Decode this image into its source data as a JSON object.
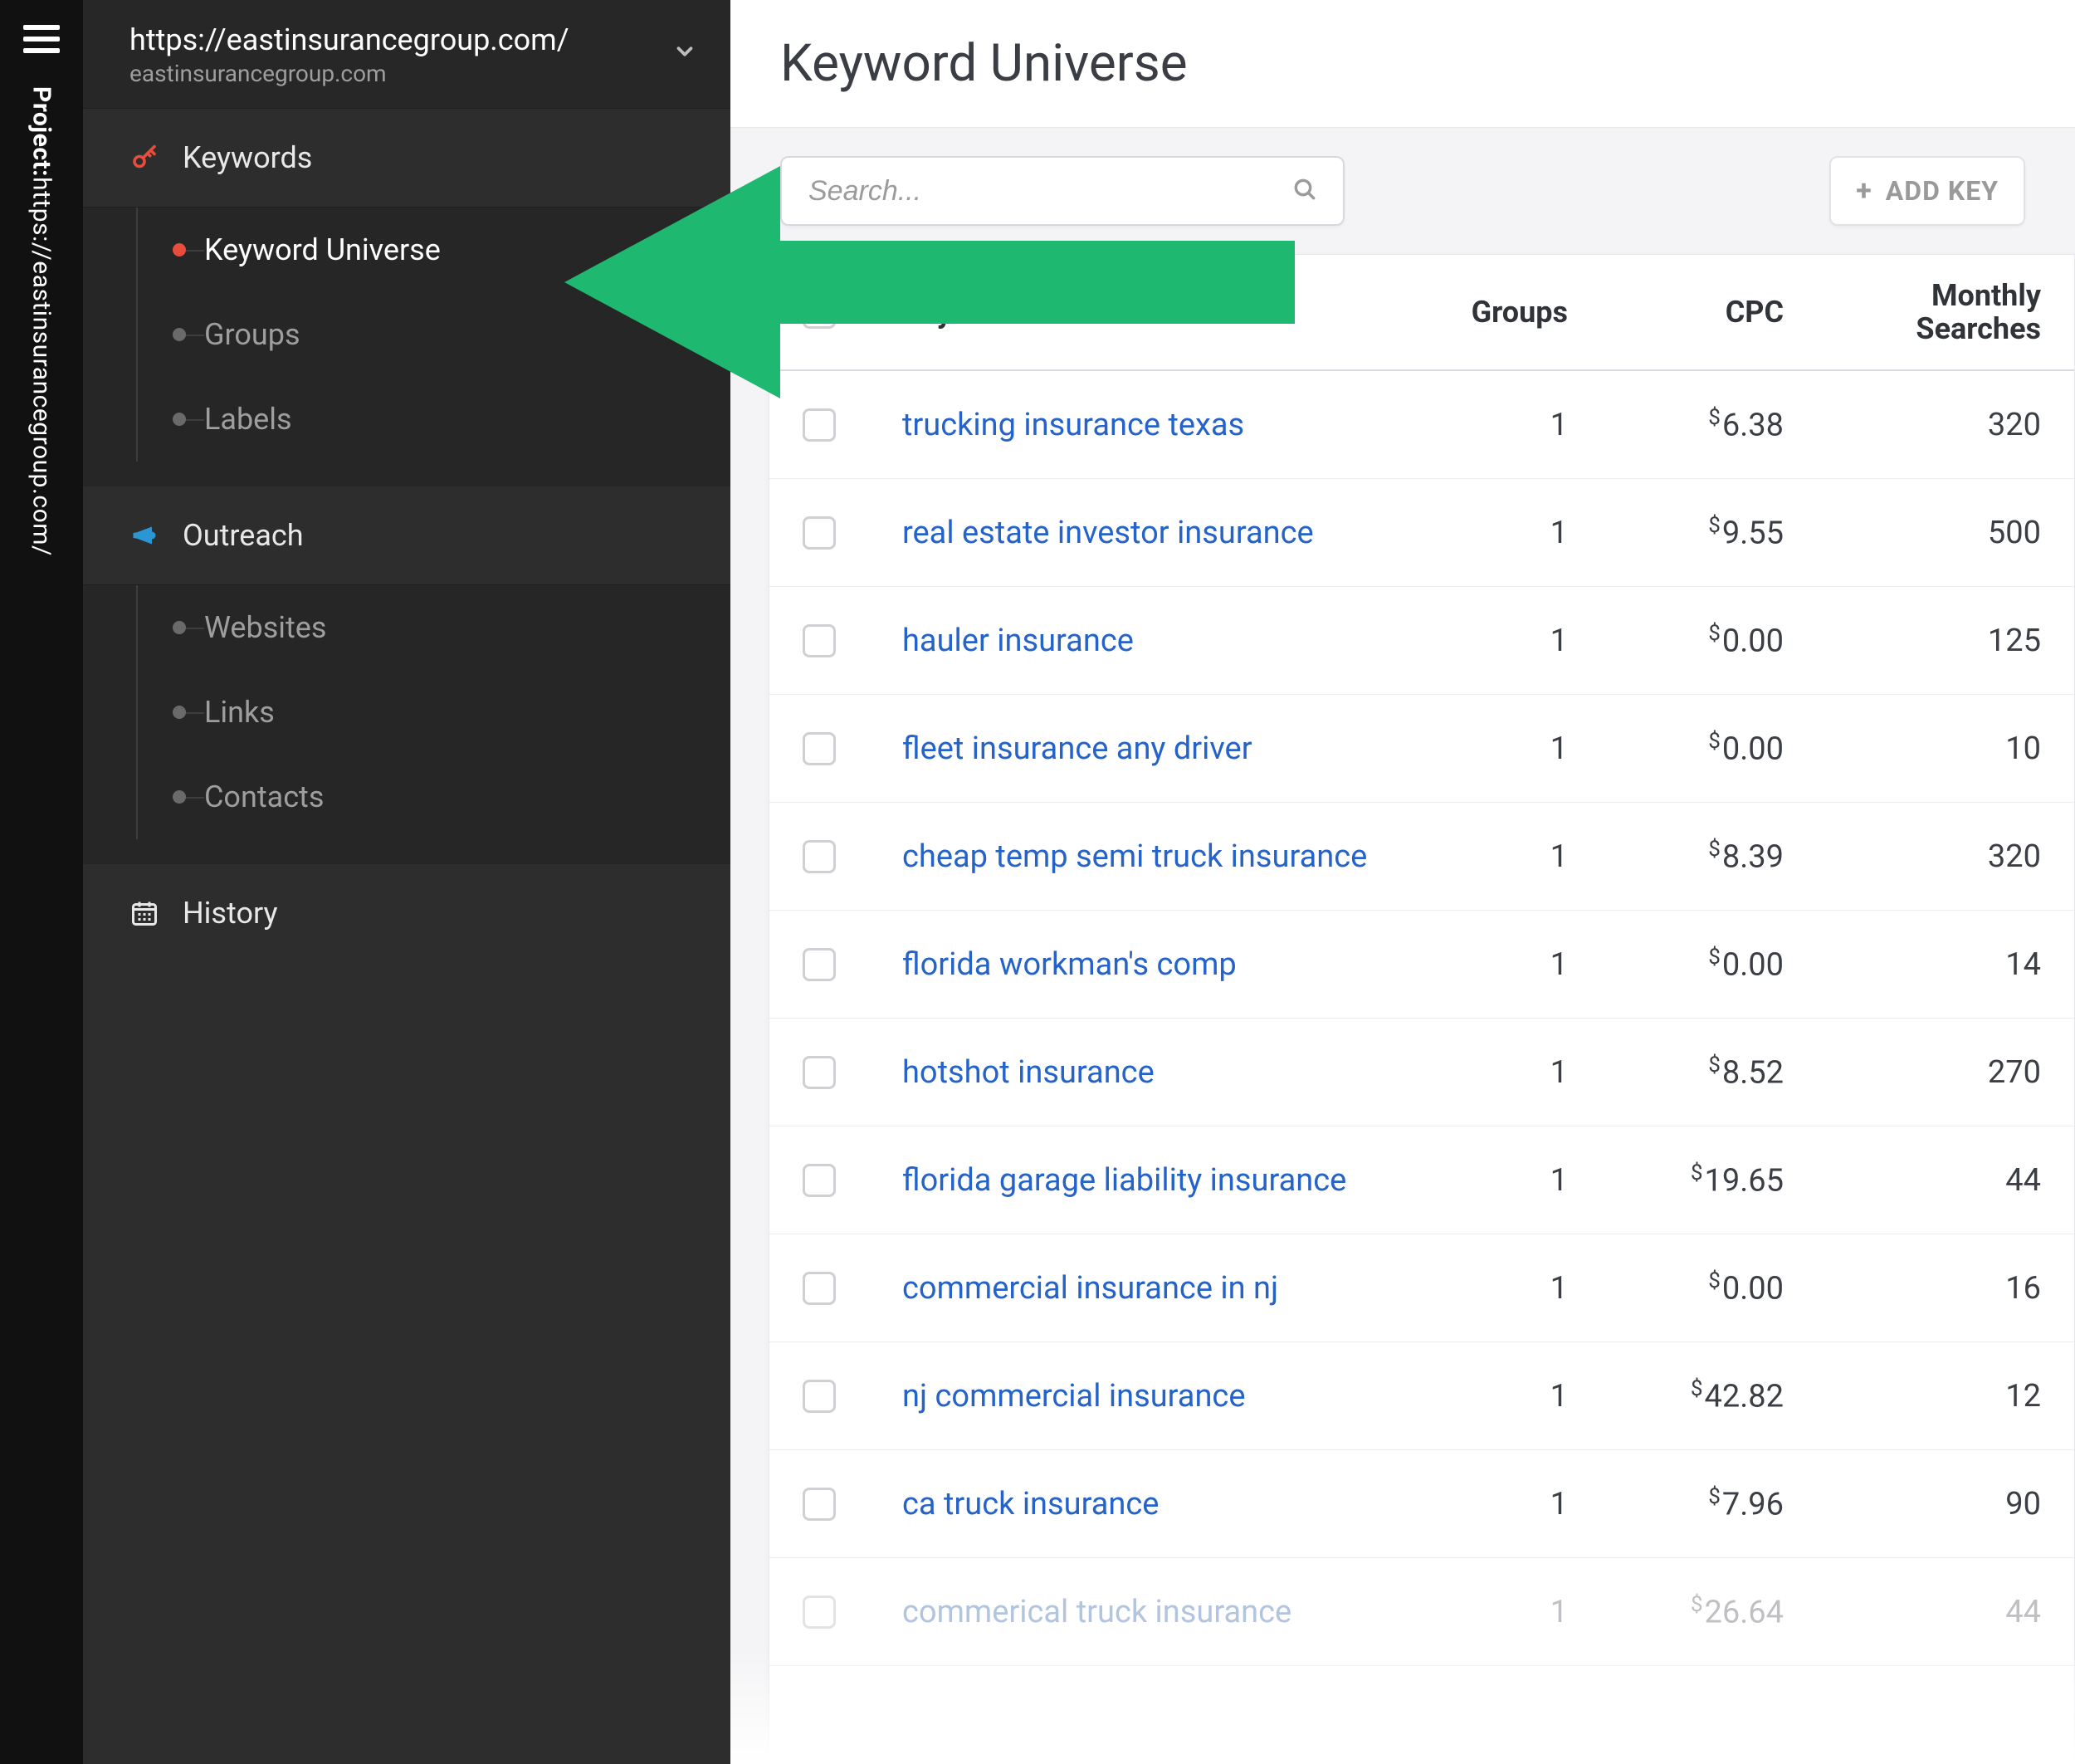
{
  "strip": {
    "project_prefix": "Project:",
    "project_value": "https://eastinsurancegroup.com/"
  },
  "project_header": {
    "url": "https://eastinsurancegroup.com/",
    "domain": "eastinsurancegroup.com"
  },
  "sidebar": {
    "sections": [
      {
        "icon": "key-icon",
        "label": "Keywords",
        "items": [
          {
            "label": "Keyword Universe",
            "active": true
          },
          {
            "label": "Groups",
            "active": false
          },
          {
            "label": "Labels",
            "active": false
          }
        ]
      },
      {
        "icon": "bullhorn-icon",
        "label": "Outreach",
        "items": [
          {
            "label": "Websites",
            "active": false
          },
          {
            "label": "Links",
            "active": false
          },
          {
            "label": "Contacts",
            "active": false
          }
        ]
      }
    ],
    "history_label": "History"
  },
  "main": {
    "title": "Keyword Universe",
    "search_placeholder": "Search...",
    "add_button_label": "ADD KEY",
    "columns": {
      "keyword": "Keyword",
      "groups": "Groups",
      "cpc": "CPC",
      "monthly": "Monthly\nSearches"
    },
    "currency_symbol": "$",
    "rows": [
      {
        "keyword": "trucking insurance texas",
        "groups": 1,
        "cpc": "6.38",
        "monthly": "320"
      },
      {
        "keyword": "real estate investor insurance",
        "groups": 1,
        "cpc": "9.55",
        "monthly": "500"
      },
      {
        "keyword": "hauler insurance",
        "groups": 1,
        "cpc": "0.00",
        "monthly": "125"
      },
      {
        "keyword": "fleet insurance any driver",
        "groups": 1,
        "cpc": "0.00",
        "monthly": "10"
      },
      {
        "keyword": "cheap temp semi truck insurance",
        "groups": 1,
        "cpc": "8.39",
        "monthly": "320"
      },
      {
        "keyword": "florida workman's comp",
        "groups": 1,
        "cpc": "0.00",
        "monthly": "14"
      },
      {
        "keyword": "hotshot insurance",
        "groups": 1,
        "cpc": "8.52",
        "monthly": "270"
      },
      {
        "keyword": "florida garage liability insurance",
        "groups": 1,
        "cpc": "19.65",
        "monthly": "44"
      },
      {
        "keyword": "commercial insurance in nj",
        "groups": 1,
        "cpc": "0.00",
        "monthly": "16"
      },
      {
        "keyword": "nj commercial insurance",
        "groups": 1,
        "cpc": "42.82",
        "monthly": "12"
      },
      {
        "keyword": "ca truck insurance",
        "groups": 1,
        "cpc": "7.96",
        "monthly": "90"
      },
      {
        "keyword": "commerical truck insurance",
        "groups": 1,
        "cpc": "26.64",
        "monthly": "44",
        "faded": true
      }
    ]
  },
  "colors": {
    "accent_red": "#e74c3c",
    "accent_blue": "#2a96d6",
    "link": "#2563c9",
    "arrow_green": "#1fb871"
  }
}
